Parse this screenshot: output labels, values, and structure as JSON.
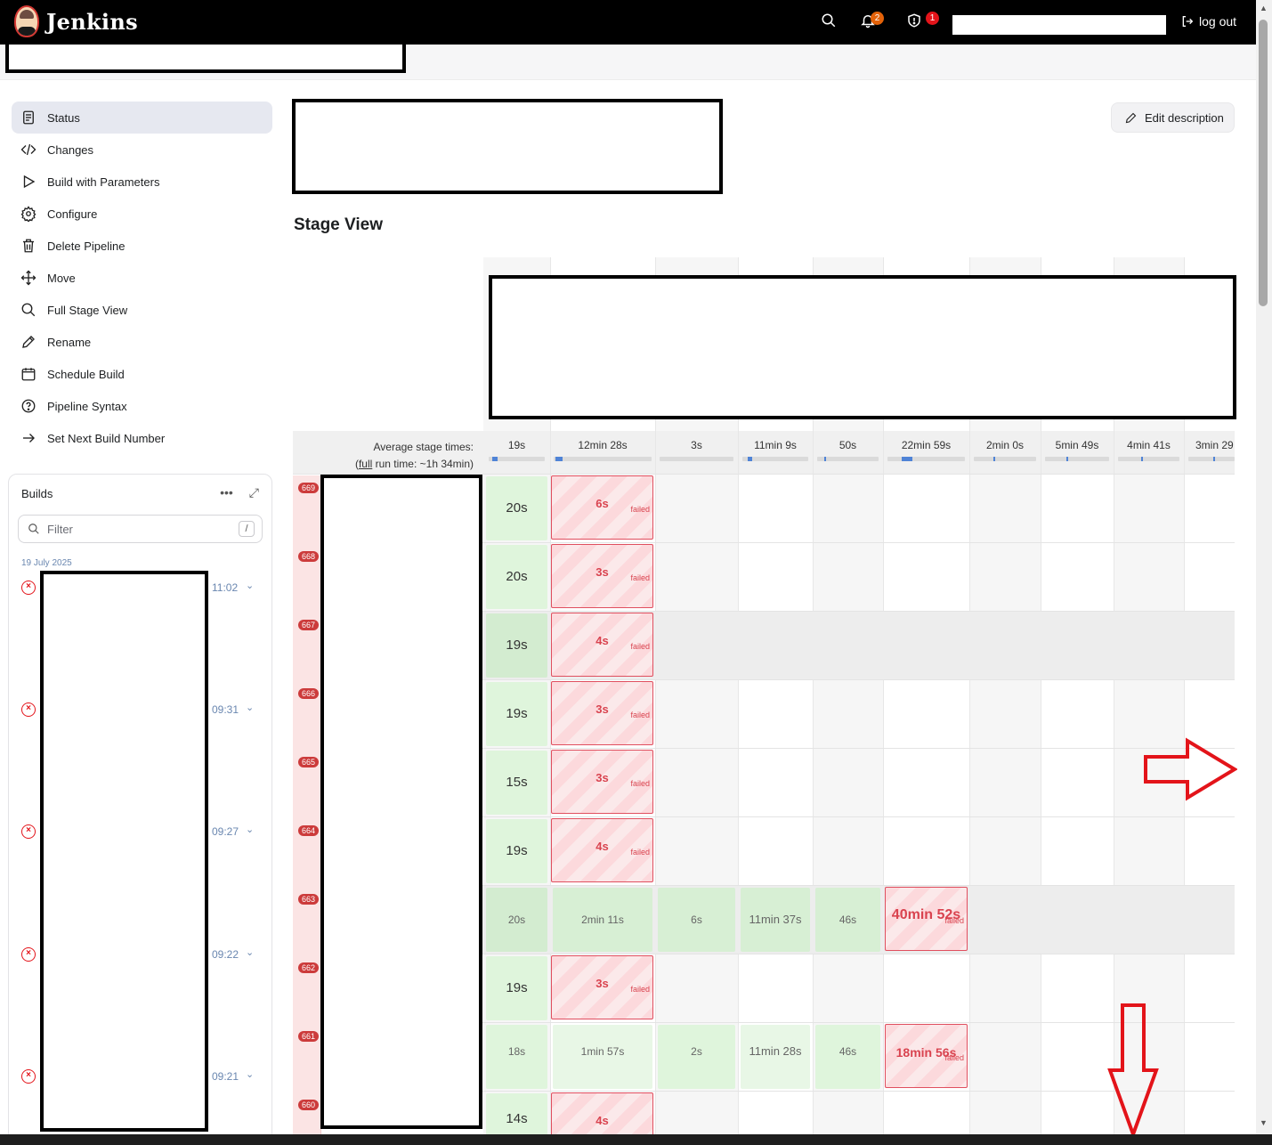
{
  "header": {
    "app_name": "Jenkins",
    "notifications_count": "2",
    "security_count": "1",
    "logout_label": "log out"
  },
  "sidebar": {
    "items": [
      {
        "label": "Status",
        "icon": "status-icon"
      },
      {
        "label": "Changes",
        "icon": "code-icon"
      },
      {
        "label": "Build with Parameters",
        "icon": "play-icon"
      },
      {
        "label": "Configure",
        "icon": "gear-icon"
      },
      {
        "label": "Delete Pipeline",
        "icon": "trash-icon"
      },
      {
        "label": "Move",
        "icon": "move-icon"
      },
      {
        "label": "Full Stage View",
        "icon": "search-icon"
      },
      {
        "label": "Rename",
        "icon": "pencil-icon"
      },
      {
        "label": "Schedule Build",
        "icon": "calendar-icon"
      },
      {
        "label": "Pipeline Syntax",
        "icon": "help-icon"
      },
      {
        "label": "Set Next Build Number",
        "icon": "arrow-right-icon"
      }
    ]
  },
  "builds": {
    "title": "Builds",
    "more_label": "•••",
    "filter_placeholder": "Filter",
    "filter_shortcut": "/",
    "date": "19 July 2025",
    "times": [
      "11:02",
      "09:31",
      "09:27",
      "09:22",
      "09:21"
    ]
  },
  "main": {
    "edit_description_label": "Edit description",
    "stage_view_title": "Stage View",
    "avg_label_line1": "Average stage times:",
    "avg_label_line2_link": "full",
    "avg_label_line2_rest": " run time: ~1h 34min)",
    "avg_label_line2_open": "(",
    "stage_avg_times": [
      "19s",
      "12min 28s",
      "3s",
      "11min 9s",
      "50s",
      "22min 59s",
      "2min 0s",
      "5min 49s",
      "4min 41s",
      "3min 29"
    ],
    "failed_label": "failed",
    "build_numbers": [
      "669",
      "668",
      "667",
      "666",
      "665",
      "664",
      "663",
      "662",
      "661",
      "660"
    ],
    "rows": [
      {
        "c0": "20s",
        "c1": "6s"
      },
      {
        "c0": "20s",
        "c1": "3s"
      },
      {
        "c0": "19s",
        "c1": "4s"
      },
      {
        "c0": "19s",
        "c1": "3s"
      },
      {
        "c0": "15s",
        "c1": "3s"
      },
      {
        "c0": "19s",
        "c1": "4s"
      },
      {
        "c0": "20s",
        "c1": "2min 11s",
        "c2": "6s",
        "c3": "11min 37s",
        "c4": "46s",
        "c5": "40min 52s"
      },
      {
        "c0": "19s",
        "c1": "3s"
      },
      {
        "c0": "18s",
        "c1": "1min 57s",
        "c2": "2s",
        "c3": "11min 28s",
        "c4": "46s",
        "c5": "18min 56s"
      },
      {
        "c0": "14s",
        "c1": "4s"
      }
    ]
  },
  "colors": {
    "accent": "#4f83d6",
    "fail": "#d9434f",
    "success": "#dff5dc",
    "annotation": "#e3141a"
  }
}
